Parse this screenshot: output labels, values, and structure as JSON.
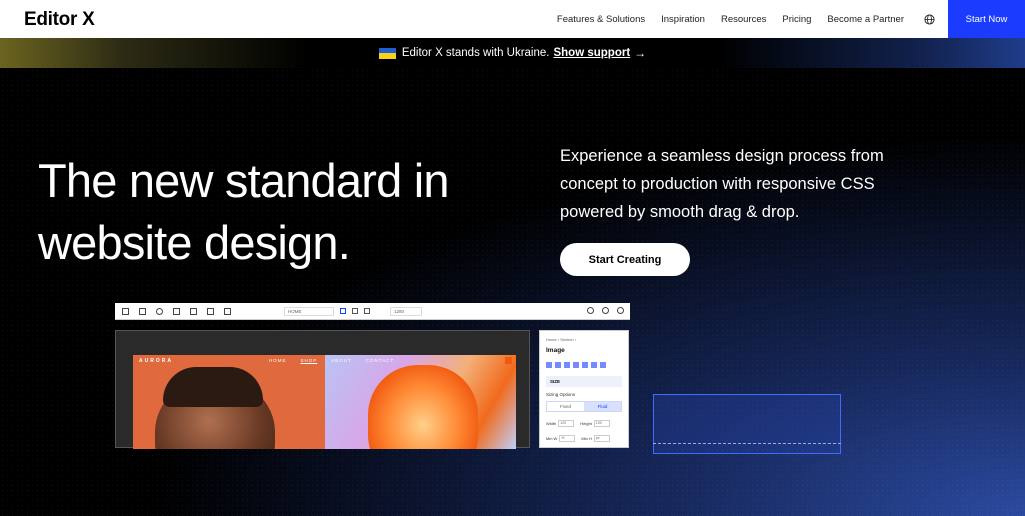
{
  "nav": {
    "logo": "Editor X",
    "links": [
      "Features & Solutions",
      "Inspiration",
      "Resources",
      "Pricing",
      "Become a Partner"
    ],
    "language_icon": "globe-icon",
    "cta": "Start Now"
  },
  "banner": {
    "text": "Editor X stands with Ukraine.",
    "link": "Show support",
    "arrow": "→"
  },
  "hero": {
    "headline": "The new standard in website design.",
    "subtext": "Experience a seamless design process from concept to production with responsive CSS powered by smooth drag & drop.",
    "cta": "Start Creating"
  },
  "editor": {
    "page_select": "HOME",
    "width_value": "1280",
    "site": {
      "brand": "AURORA",
      "menu": [
        "HOME",
        "SHOP",
        "ABOUT",
        "CONTACT"
      ]
    },
    "panel": {
      "breadcrumb": "Home › Section ›",
      "title": "Image",
      "size_label": "SIZE",
      "sizing_label": "Sizing Options",
      "toggle": [
        "Fixed",
        "Fluid"
      ],
      "fields": [
        {
          "label": "Width",
          "value": "120"
        },
        {
          "label": "Height",
          "value": "100"
        }
      ],
      "fields2": [
        {
          "label": "Min W",
          "value": "%"
        },
        {
          "label": "Min H",
          "value": "px"
        }
      ]
    }
  },
  "colors": {
    "accent": "#1b3cff",
    "background": "#000000"
  }
}
